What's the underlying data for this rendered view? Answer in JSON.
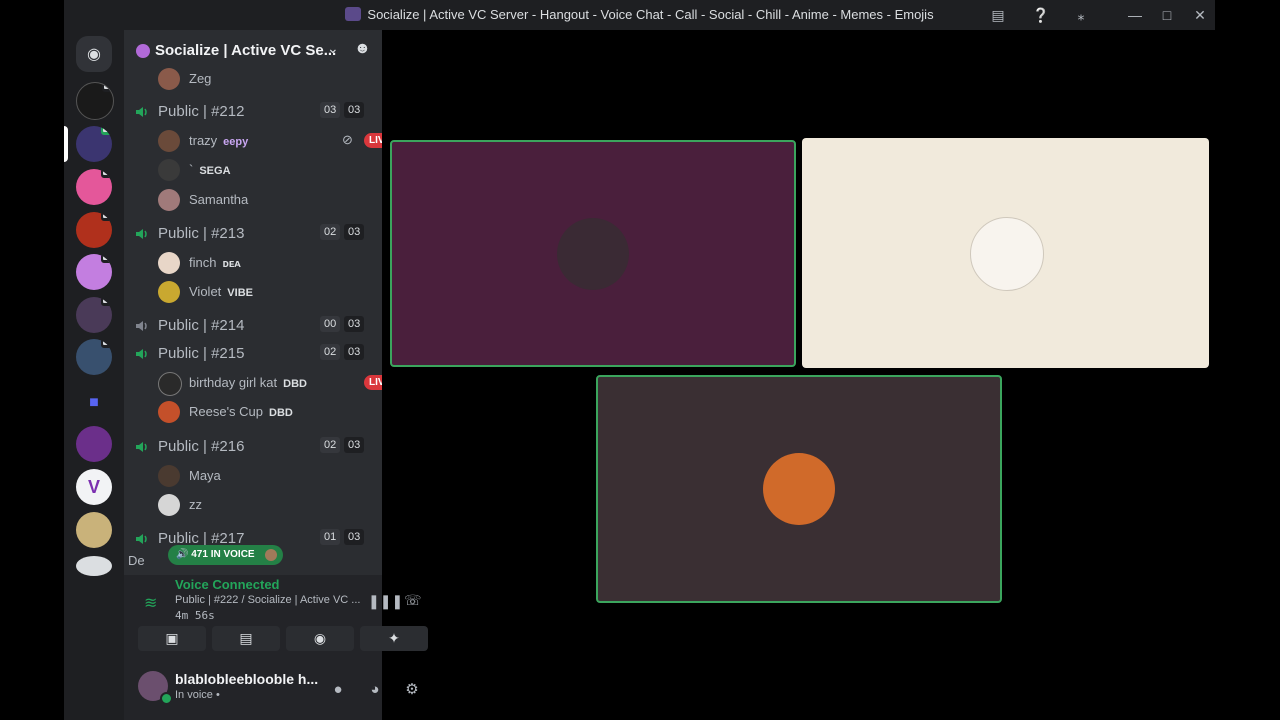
{
  "window": {
    "title": "Socialize | Active VC Server - Hangout - Voice Chat - Call - Social - Chill - Anime - Memes - Emojis"
  },
  "server": {
    "name": "Socialize | Active VC Se..."
  },
  "channels": [
    {
      "name": "Public | #212",
      "count": "03",
      "limit": "03"
    },
    {
      "name": "Public | #213",
      "count": "02",
      "limit": "03"
    },
    {
      "name": "Public | #214",
      "count": "00",
      "limit": "03"
    },
    {
      "name": "Public | #215",
      "count": "02",
      "limit": "03"
    },
    {
      "name": "Public | #216",
      "count": "02",
      "limit": "03"
    },
    {
      "name": "Public | #217",
      "count": "01",
      "limit": "03"
    }
  ],
  "users": {
    "zeg": {
      "name": "Zeg"
    },
    "trazy": {
      "name": "trazy",
      "tag": "eepy",
      "live": "LIVE"
    },
    "sega": {
      "name": "`",
      "tag": "SEGA"
    },
    "samantha": {
      "name": "Samantha"
    },
    "finch": {
      "name": "finch",
      "tag": "ᴅᴇᴀ"
    },
    "violet": {
      "name": "Violet",
      "tag": "VIBE"
    },
    "kat": {
      "name": "birthday girl kat",
      "tag": "DBD",
      "live": "LIVE"
    },
    "reese": {
      "name": "Reese's Cup",
      "tag": "DBD"
    },
    "maya": {
      "name": "Maya"
    },
    "zz": {
      "name": "zz"
    },
    "de": {
      "name": "De"
    }
  },
  "in_voice": "471 IN VOICE",
  "voice_panel": {
    "status": "Voice Connected",
    "location": "Public | #222 / Socialize | Active VC ...",
    "time": "4m 56s"
  },
  "user_panel": {
    "username": "blablobleeblooble h...",
    "status": "In voice •"
  },
  "colors": {
    "accent_green": "#23a55a",
    "live_red": "#da373c",
    "tile1_bg": "#4a1f3c",
    "tile2_bg": "#f1eadc",
    "tile3_bg": "#3a2f33"
  }
}
